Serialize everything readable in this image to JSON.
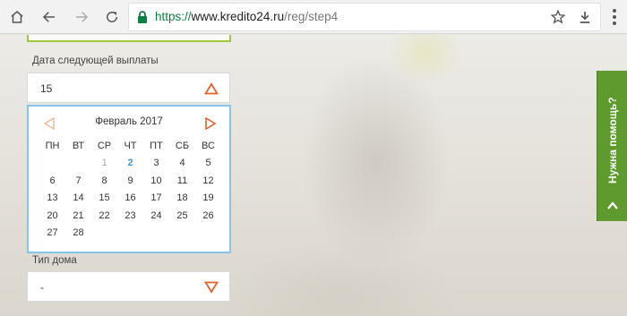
{
  "browser": {
    "url_scheme": "https://",
    "url_host": "www.kredito24.ru",
    "url_path": "/reg/step4",
    "icons": [
      "home-icon",
      "back-icon",
      "forward-icon",
      "reload-icon",
      "lock-icon",
      "star-icon",
      "download-icon",
      "menu-icon"
    ]
  },
  "form": {
    "payment_date_label": "Дата следующей выплаты",
    "payment_date_value": "15",
    "house_type_label": "Тип дома",
    "house_type_value": "-"
  },
  "calendar": {
    "month_title": "Февраль 2017",
    "weekdays": [
      "ПН",
      "ВТ",
      "СР",
      "ЧТ",
      "ПТ",
      "СБ",
      "ВС"
    ],
    "weeks": [
      [
        "",
        "",
        "1",
        "2",
        "3",
        "4",
        "5"
      ],
      [
        "6",
        "7",
        "8",
        "9",
        "10",
        "11",
        "12"
      ],
      [
        "13",
        "14",
        "15",
        "16",
        "17",
        "18",
        "19"
      ],
      [
        "20",
        "21",
        "22",
        "23",
        "24",
        "25",
        "26"
      ],
      [
        "27",
        "28",
        "",
        "",
        "",
        "",
        ""
      ]
    ],
    "past_days": [
      "1"
    ],
    "highlight_day": "2"
  },
  "help": {
    "label": "Нужна помощь?"
  },
  "colors": {
    "accent_orange": "#e0622a",
    "calendar_border": "#86c5ea",
    "help_green": "#5e9a2e",
    "field_green": "#9cc93a",
    "secure_green": "#0b8043"
  }
}
